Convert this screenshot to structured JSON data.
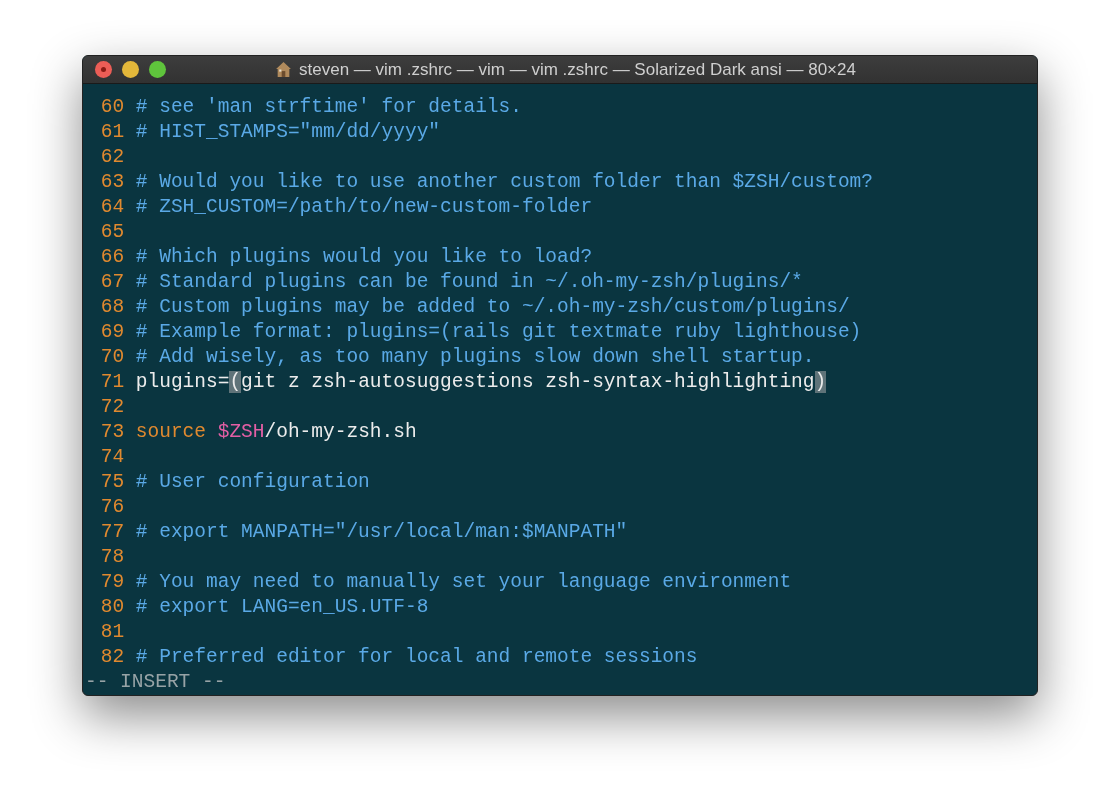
{
  "window": {
    "title": "steven — vim .zshrc — vim — vim .zshrc — Solarized Dark ansi — 80×24"
  },
  "lines": [
    {
      "number": "60",
      "segments": [
        {
          "kind": "comment",
          "text": "# see 'man strftime' for details."
        }
      ]
    },
    {
      "number": "61",
      "segments": [
        {
          "kind": "comment",
          "text": "# HIST_STAMPS=\"mm/dd/yyyy\""
        }
      ]
    },
    {
      "number": "62"
    },
    {
      "number": "63",
      "segments": [
        {
          "kind": "comment",
          "text": "# Would you like to use another custom folder than $ZSH/custom?"
        }
      ]
    },
    {
      "number": "64",
      "segments": [
        {
          "kind": "comment",
          "text": "# ZSH_CUSTOM=/path/to/new-custom-folder"
        }
      ]
    },
    {
      "number": "65"
    },
    {
      "number": "66",
      "segments": [
        {
          "kind": "comment",
          "text": "# Which plugins would you like to load?"
        }
      ]
    },
    {
      "number": "67",
      "segments": [
        {
          "kind": "comment",
          "text": "# Standard plugins can be found in ~/.oh-my-zsh/plugins/*"
        }
      ]
    },
    {
      "number": "68",
      "segments": [
        {
          "kind": "comment",
          "text": "# Custom plugins may be added to ~/.oh-my-zsh/custom/plugins/"
        }
      ]
    },
    {
      "number": "69",
      "segments": [
        {
          "kind": "comment",
          "text": "# Example format: plugins=(rails git textmate ruby lighthouse)"
        }
      ]
    },
    {
      "number": "70",
      "segments": [
        {
          "kind": "comment",
          "text": "# Add wisely, as too many plugins slow down shell startup."
        }
      ]
    },
    {
      "number": "71",
      "segments": [
        {
          "kind": "plain",
          "text": "plugins="
        },
        {
          "kind": "match",
          "text": "("
        },
        {
          "kind": "plain",
          "text": "git z zsh-autosuggestions zsh-syntax-highlighting"
        },
        {
          "kind": "match",
          "text": ")"
        }
      ]
    },
    {
      "number": "72"
    },
    {
      "number": "73",
      "segments": [
        {
          "kind": "keyword",
          "text": "source"
        },
        {
          "kind": "variable",
          "text": " $ZSH"
        },
        {
          "kind": "plain",
          "text": "/oh-my-zsh.sh"
        }
      ]
    },
    {
      "number": "74"
    },
    {
      "number": "75",
      "segments": [
        {
          "kind": "comment",
          "text": "# User configuration"
        }
      ]
    },
    {
      "number": "76"
    },
    {
      "number": "77",
      "segments": [
        {
          "kind": "comment",
          "text": "# export MANPATH=\"/usr/local/man:$MANPATH\""
        }
      ]
    },
    {
      "number": "78"
    },
    {
      "number": "79",
      "segments": [
        {
          "kind": "comment",
          "text": "# You may need to manually set your language environment"
        }
      ]
    },
    {
      "number": "80",
      "segments": [
        {
          "kind": "comment",
          "text": "# export LANG=en_US.UTF-8"
        }
      ]
    },
    {
      "number": "81"
    },
    {
      "number": "82",
      "segments": [
        {
          "kind": "comment",
          "text": "# Preferred editor for local and remote sessions"
        }
      ]
    }
  ],
  "status_line": "-- INSERT --"
}
